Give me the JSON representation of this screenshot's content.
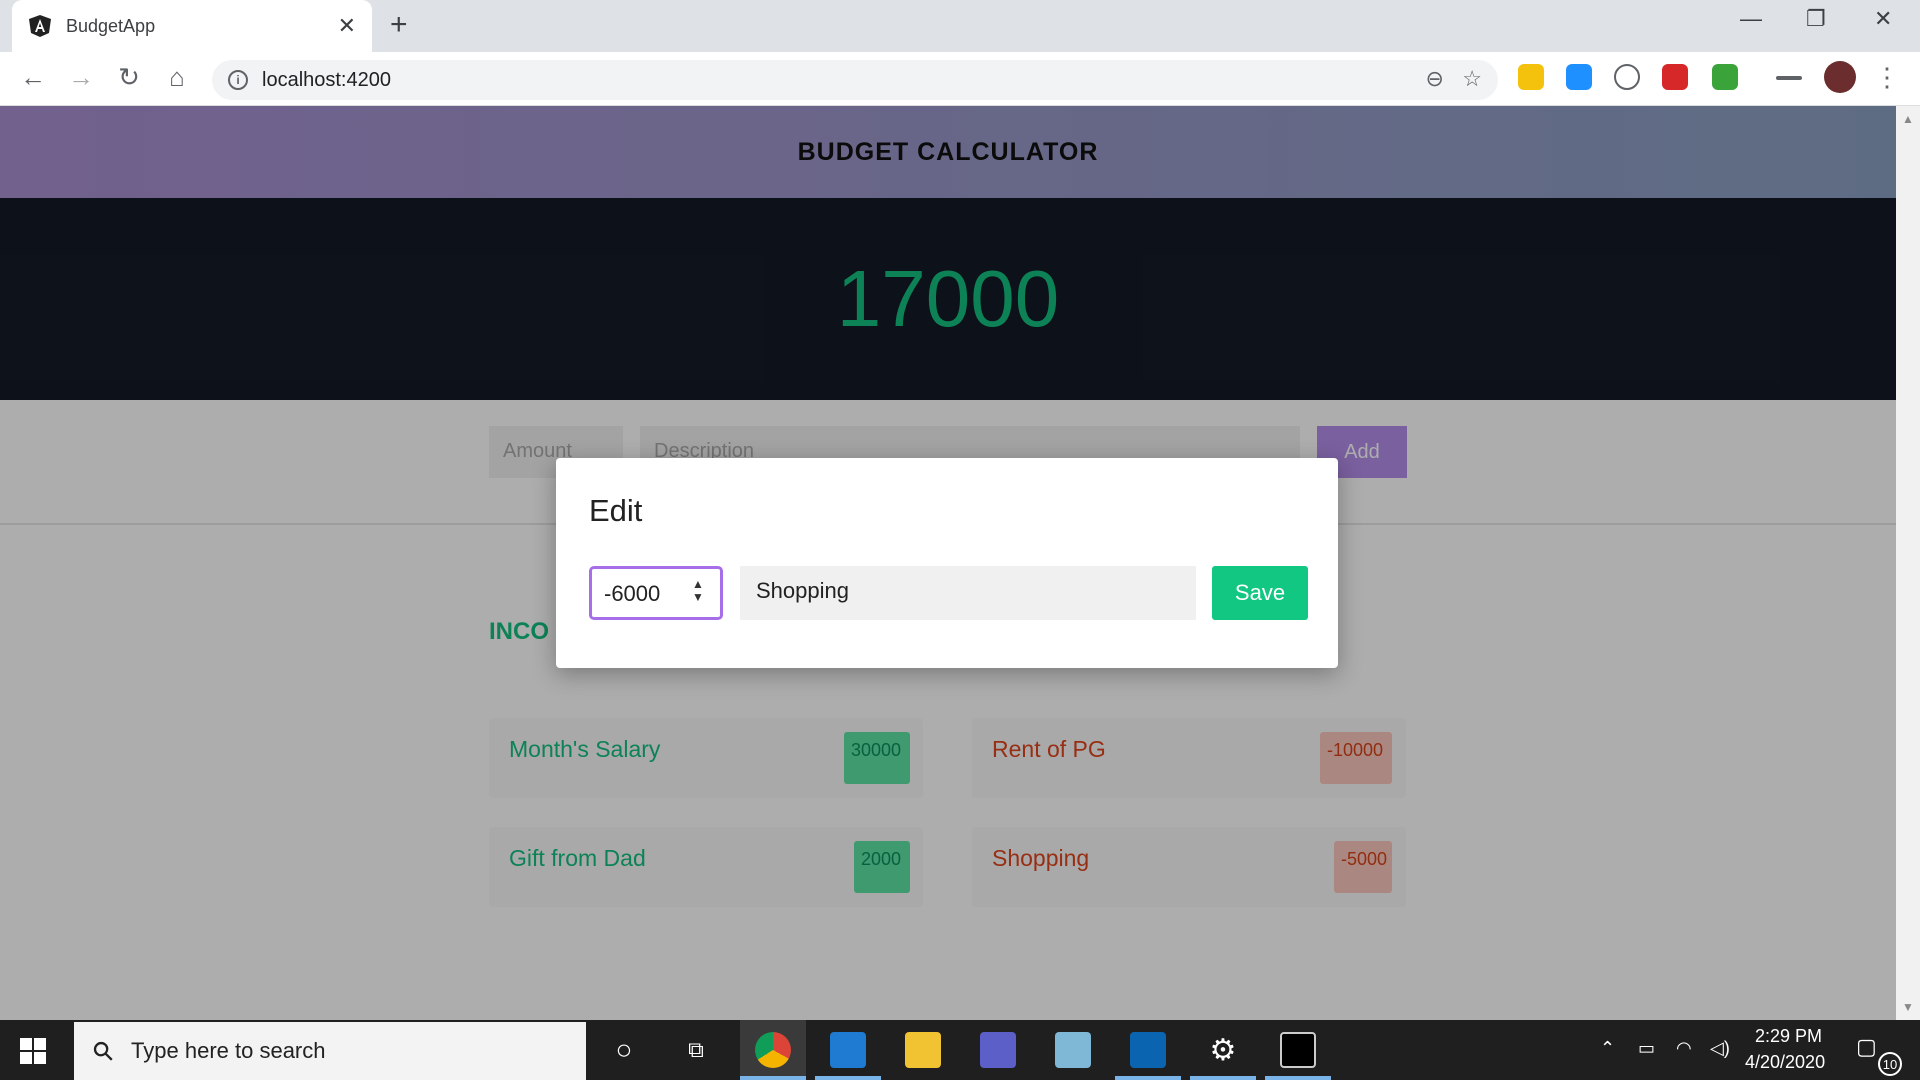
{
  "browser": {
    "tab_title": "BudgetApp",
    "url": "localhost:4200"
  },
  "app": {
    "header_title": "BUDGET CALCULATOR",
    "balance": "17000",
    "add_form": {
      "amount_placeholder": "Amount",
      "description_placeholder": "Description",
      "add_label": "Add"
    },
    "section_title": "INCO",
    "income_items": [
      {
        "label": "Month's Salary",
        "amount": "30000"
      },
      {
        "label": "Gift from Dad",
        "amount": "2000"
      }
    ],
    "expense_items": [
      {
        "label": "Rent of PG",
        "amount": "-10000"
      },
      {
        "label": "Shopping",
        "amount": "-5000"
      }
    ]
  },
  "modal": {
    "title": "Edit",
    "amount_value": "-6000",
    "description_value": "Shopping",
    "save_label": "Save"
  },
  "taskbar": {
    "search_placeholder": "Type here to search",
    "time": "2:29 PM",
    "date": "4/20/2020",
    "notification_count": "10"
  },
  "colors": {
    "accent_green": "#14c07f",
    "accent_purple": "#a66ee8",
    "expense_red": "#e0441c",
    "dark_panel": "#141a26"
  }
}
